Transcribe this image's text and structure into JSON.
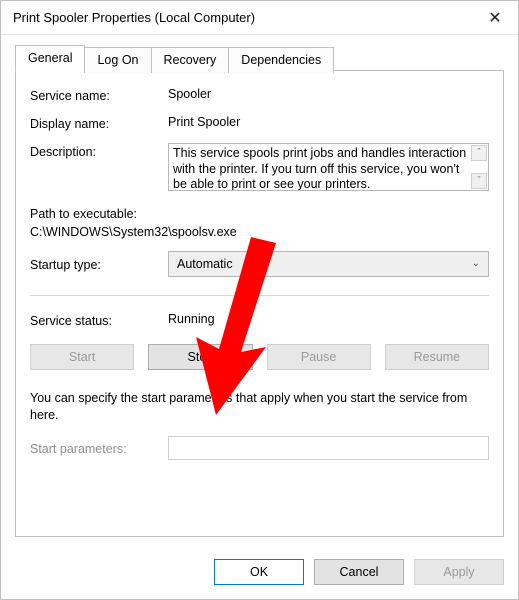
{
  "window": {
    "title": "Print Spooler Properties (Local Computer)"
  },
  "tabs": {
    "general": "General",
    "log_on": "Log On",
    "recovery": "Recovery",
    "dependencies": "Dependencies"
  },
  "fields": {
    "service_name_label": "Service name:",
    "service_name_value": "Spooler",
    "display_name_label": "Display name:",
    "display_name_value": "Print Spooler",
    "description_label": "Description:",
    "description_value": "This service spools print jobs and handles interaction with the printer.  If you turn off this service, you won't be able to print or see your printers.",
    "path_label": "Path to executable:",
    "path_value": "C:\\WINDOWS\\System32\\spoolsv.exe",
    "startup_type_label": "Startup type:",
    "startup_type_value": "Automatic",
    "service_status_label": "Service status:",
    "service_status_value": "Running",
    "help_text": "You can specify the start parameters that apply when you start the service from here.",
    "start_params_label": "Start parameters:",
    "start_params_value": ""
  },
  "buttons": {
    "start": "Start",
    "stop": "Stop",
    "pause": "Pause",
    "resume": "Resume",
    "ok": "OK",
    "cancel": "Cancel",
    "apply": "Apply"
  }
}
